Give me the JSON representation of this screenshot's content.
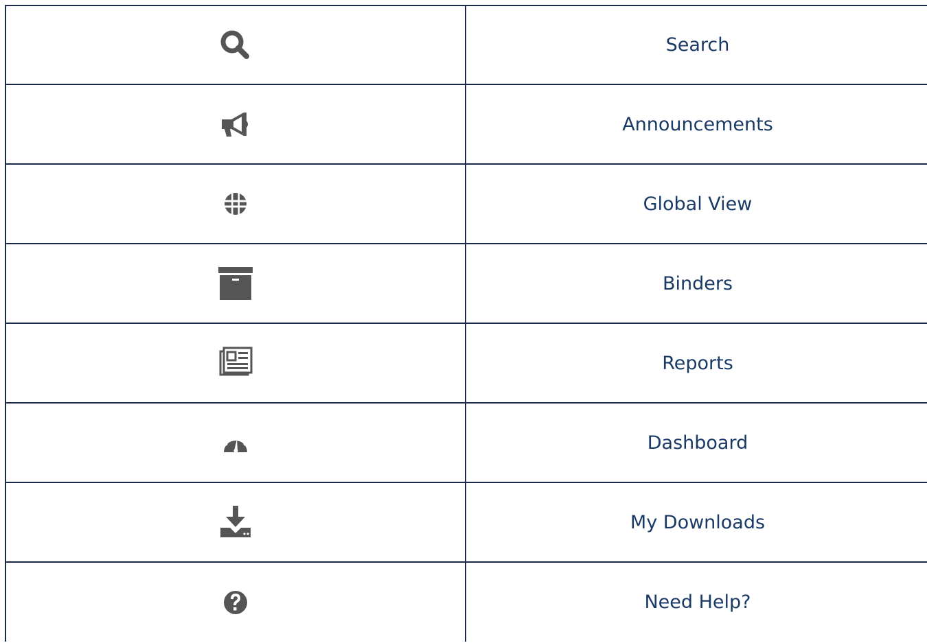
{
  "colors": {
    "border": "#1c2a4a",
    "icon": "#555555",
    "label_text": "#1a3a66"
  },
  "menu": {
    "items": [
      {
        "icon": "search-icon",
        "label": "Search"
      },
      {
        "icon": "megaphone-icon",
        "label": "Announcements"
      },
      {
        "icon": "globe-icon",
        "label": "Global View"
      },
      {
        "icon": "archive-box-icon",
        "label": "Binders"
      },
      {
        "icon": "newspaper-icon",
        "label": "Reports"
      },
      {
        "icon": "dashboard-gauge-icon",
        "label": "Dashboard"
      },
      {
        "icon": "download-icon",
        "label": "My Downloads"
      },
      {
        "icon": "question-circle-icon",
        "label": "Need Help?"
      }
    ]
  }
}
